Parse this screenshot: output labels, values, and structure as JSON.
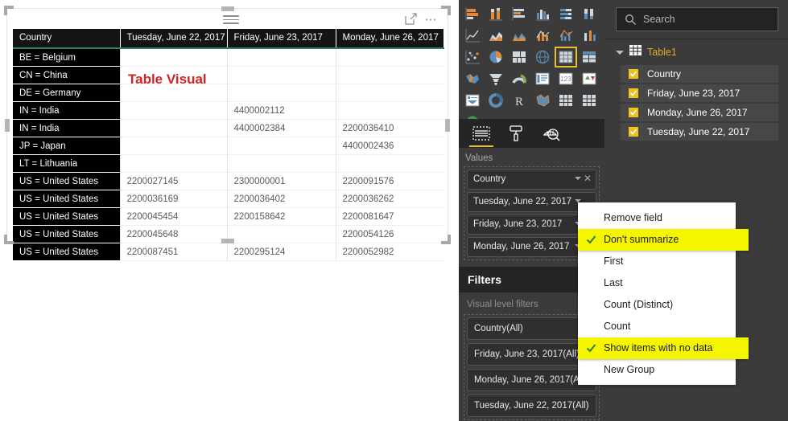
{
  "visual": {
    "overlay_label": "Table Visual",
    "hamburger_icon": "menu-icon",
    "focus_icon": "focus-mode-icon",
    "more_icon": "more-options-icon",
    "columns": [
      "Country",
      "Tuesday, June 22, 2017",
      "Friday, June 23, 2017",
      "Monday, June 26, 2017"
    ],
    "rows": [
      [
        "BE = Belgium",
        "",
        "",
        ""
      ],
      [
        "CN = China",
        "",
        "",
        ""
      ],
      [
        "DE = Germany",
        "",
        "",
        ""
      ],
      [
        "IN = India",
        "",
        "4400002112",
        ""
      ],
      [
        "IN = India",
        "",
        "4400002384",
        "2200036410"
      ],
      [
        "JP = Japan",
        "",
        "",
        "4400002436"
      ],
      [
        "LT = Lithuania",
        "",
        "",
        ""
      ],
      [
        "US = United States",
        "2200027145",
        "2300000001",
        "2200091576"
      ],
      [
        "US = United States",
        "2200036169",
        "2200036402",
        "2200036262"
      ],
      [
        "US = United States",
        "2200045454",
        "2200158642",
        "2200081647"
      ],
      [
        "US = United States",
        "2200045648",
        "",
        "2200054126"
      ],
      [
        "US = United States",
        "2200087451",
        "2200295124",
        "2200052982"
      ]
    ]
  },
  "visualizations": {
    "icons": [
      "stacked-bar-chart-icon",
      "stacked-column-chart-icon",
      "clustered-bar-chart-icon",
      "clustered-column-chart-icon",
      "hundred-percent-stacked-bar-chart-icon",
      "hundred-percent-stacked-column-chart-icon",
      "line-chart-icon",
      "area-chart-icon",
      "stacked-area-chart-icon",
      "line-and-stacked-column-chart-icon",
      "line-and-clustered-column-chart-icon",
      "ribbon-chart-icon",
      "scatter-chart-icon",
      "pie-chart-icon",
      "treemap-icon",
      "map-icon",
      "table-icon",
      "matrix-icon",
      "filled-map-icon",
      "funnel-icon",
      "gauge-icon",
      "multi-row-card-icon",
      "card-icon",
      "kpi-icon",
      "slicer-icon",
      "donut-chart-icon",
      "r-script-visual-icon",
      "shape-map-icon",
      "matrix-alt-icon",
      "table-alt-icon",
      "arcgis-map-icon"
    ],
    "selected_icon": "table-icon",
    "ellipsis": "more-visuals-icon"
  },
  "viz_tabs": [
    {
      "name": "fields-tab",
      "icon": "fields-pane-icon",
      "active": true
    },
    {
      "name": "format-tab",
      "icon": "paint-roller-icon",
      "active": false
    },
    {
      "name": "analytics-tab",
      "icon": "analytics-magnifier-icon",
      "active": false
    }
  ],
  "values": {
    "title": "Values",
    "fields": [
      {
        "label": "Country",
        "has_remove": true
      },
      {
        "label": "Tuesday, June 22, 2017",
        "has_remove": false
      },
      {
        "label": "Friday, June 23, 2017",
        "has_remove": false
      },
      {
        "label": "Monday, June 26, 2017",
        "has_remove": false
      }
    ]
  },
  "filters": {
    "title": "Filters",
    "subtitle": "Visual level filters",
    "items": [
      "Country(All)",
      "Friday, June 23, 2017(All)",
      "Monday, June 26, 2017(All)",
      "Tuesday, June 22, 2017(All)"
    ]
  },
  "fields_pane": {
    "search_placeholder": "Search",
    "search_value": "",
    "search_icon": "search-icon",
    "table_icon": "table-grid-icon",
    "table_name": "Table1",
    "fields": [
      {
        "label": "Country",
        "checked": true
      },
      {
        "label": "Friday, June 23, 2017",
        "checked": true
      },
      {
        "label": "Monday, June 26, 2017",
        "checked": true
      },
      {
        "label": "Tuesday, June 22, 2017",
        "checked": true
      }
    ]
  },
  "context_menu": {
    "items": [
      {
        "label": "Remove field",
        "checked": false,
        "highlighted": false
      },
      {
        "label": "Don't summarize",
        "checked": true,
        "highlighted": true
      },
      {
        "label": "First",
        "checked": false,
        "highlighted": false
      },
      {
        "label": "Last",
        "checked": false,
        "highlighted": false
      },
      {
        "label": "Count (Distinct)",
        "checked": false,
        "highlighted": false
      },
      {
        "label": "Count",
        "checked": false,
        "highlighted": false
      },
      {
        "label": "Show items with no data",
        "checked": true,
        "highlighted": true
      },
      {
        "label": "New Group",
        "checked": false,
        "highlighted": false
      }
    ]
  },
  "colors": {
    "accent_yellow": "#f5f500",
    "checkbox_yellow": "#f0c020",
    "table_name_orange": "#e5a82e",
    "header_underline": "#2f7f74",
    "overlay_red": "#d42222",
    "panel_bg": "#3b3b3b"
  }
}
